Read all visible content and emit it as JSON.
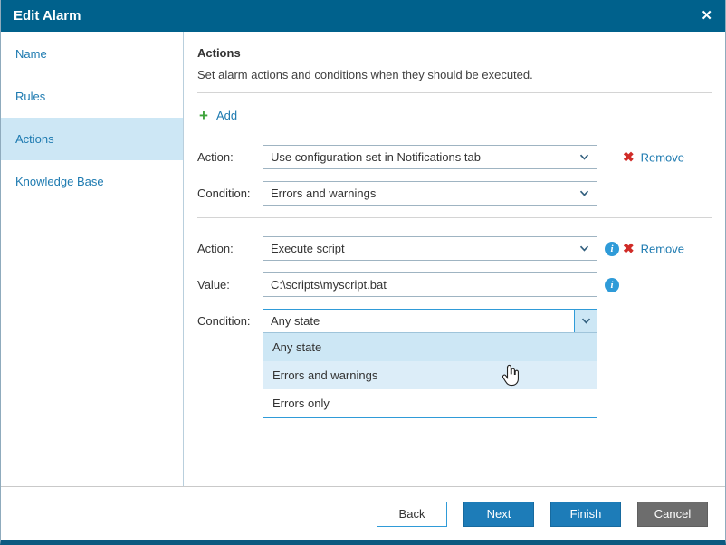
{
  "dialog": {
    "title": "Edit Alarm",
    "close_glyph": "✕"
  },
  "sidebar": {
    "items": [
      {
        "label": "Name"
      },
      {
        "label": "Rules"
      },
      {
        "label": "Actions"
      },
      {
        "label": "Knowledge Base"
      }
    ],
    "selected": "Actions"
  },
  "content": {
    "heading": "Actions",
    "subtitle": "Set alarm actions and conditions when they should be executed.",
    "add": {
      "icon": "+",
      "label": "Add"
    },
    "group1": {
      "action_label": "Action:",
      "action_value": "Use configuration set in Notifications tab",
      "condition_label": "Condition:",
      "condition_value": "Errors and warnings",
      "remove_icon": "✖",
      "remove_label": "Remove"
    },
    "group2": {
      "action_label": "Action:",
      "action_value": "Execute script",
      "value_label": "Value:",
      "value_text": "C:\\scripts\\myscript.bat",
      "condition_label": "Condition:",
      "condition_value": "Any state",
      "remove_icon": "✖",
      "remove_label": "Remove",
      "info_glyph": "i"
    },
    "dropdown": {
      "options": [
        {
          "label": "Any state",
          "state": "selected"
        },
        {
          "label": "Errors and warnings",
          "state": "hovered"
        },
        {
          "label": "Errors only",
          "state": "normal"
        }
      ]
    }
  },
  "footer": {
    "back": "Back",
    "next": "Next",
    "finish": "Finish",
    "cancel": "Cancel"
  },
  "colors": {
    "titlebar": "#00618c",
    "accent_blue": "#1d7ab0",
    "selection": "#cde7f5",
    "focus_border": "#2f9bd8",
    "remove_red": "#d02b27",
    "add_green": "#3da33a",
    "button_primary": "#1d7cb8",
    "button_gray": "#6d6d6d"
  }
}
